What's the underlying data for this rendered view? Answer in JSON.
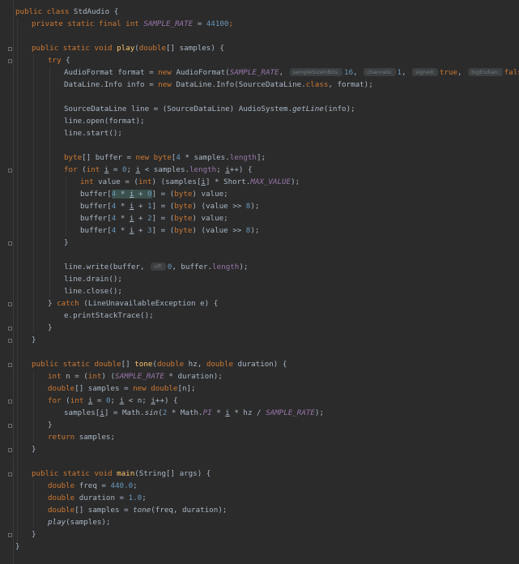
{
  "code": {
    "l1": [
      "public class StdAudio {"
    ],
    "l2": [
      "private static final int SAMPLE_RATE = 44100;"
    ],
    "l4": [
      "public static void play(double[] samples) {"
    ],
    "l5": [
      "try {"
    ],
    "l6": {
      "a": "AudioFormat format = new AudioFormat(",
      "c1": "SAMPLE_RATE",
      "h1": "sampleSizeInBits:",
      "v1": "16",
      "h2": "channels:",
      "v2": "1",
      "h3": "signed:",
      "v3": "true",
      "h4": "bigEndian:",
      "v4": "false"
    },
    "l7": "DataLine.Info info = new DataLine.Info(SourceDataLine.class, format);",
    "l9": "SourceDataLine line = (SourceDataLine) AudioSystem.getLine(info);",
    "l10": "line.open(format);",
    "l11": "line.start();",
    "l13": "byte[] buffer = new byte[4 * samples.length];",
    "l14": "for (int i = 0; i < samples.length; i++) {",
    "l15": "int value = (int) (samples[i] * Short.MAX_VALUE);",
    "l16": "buffer[4 * i + 0] = (byte) value;",
    "l17": "buffer[4 * i + 1] = (byte) (value >> 8);",
    "l18": "buffer[4 * i + 2] = (byte) value;",
    "l19": "buffer[4 * i + 3] = (byte) (value >> 8);",
    "l20": "}",
    "l22": {
      "a": "line.write(buffer, ",
      "h": "off:",
      "b": "0, buffer.length);"
    },
    "l23": "line.drain();",
    "l24": "line.close();",
    "l25": "} catch (LineUnavailableException e) {",
    "l26": "e.printStackTrace();",
    "l27": "}",
    "l28": "}",
    "l30": "public static double[] tone(double hz, double duration) {",
    "l31": "int n = (int) (SAMPLE_RATE * duration);",
    "l32": "double[] samples = new double[n];",
    "l33": "for (int i = 0; i < n; i++) {",
    "l34": "samples[i] = Math.sin(2 * Math.PI * i * hz / SAMPLE_RATE);",
    "l35": "}",
    "l36": "return samples;",
    "l37": "}",
    "l39": "public static void main(String[] args) {",
    "l40": "double freq = 440.0;",
    "l41": "double duration = 1.0;",
    "l42": "double[] samples = tone(freq, duration);",
    "l43": "play(samples);",
    "l44": "}",
    "l45": "}"
  },
  "colors": {
    "background": "#2b2b2b",
    "keyword": "#cc7832",
    "method": "#ffc66d",
    "number": "#6897bb",
    "constant": "#9876aa",
    "text": "#a9b7c6"
  }
}
